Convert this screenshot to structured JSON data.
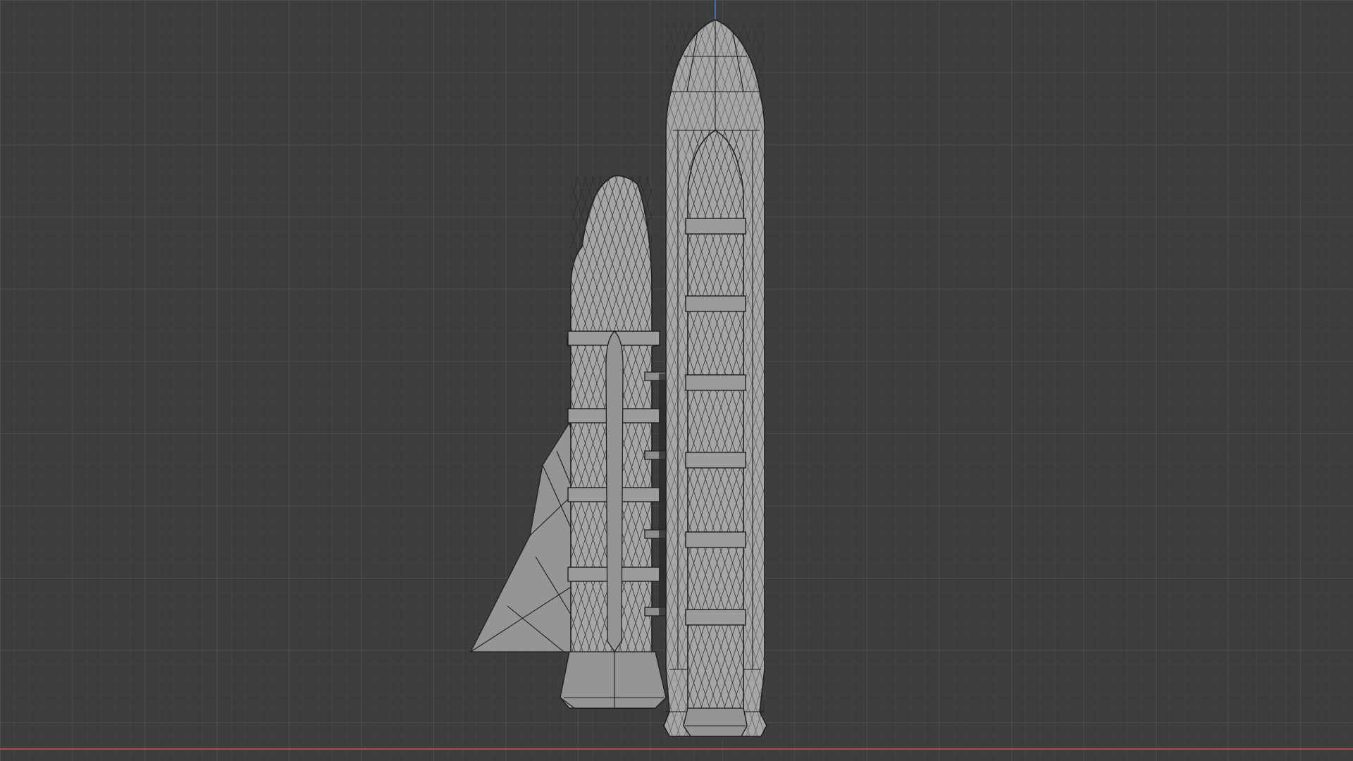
{
  "viewport": {
    "editor": "3D Viewport",
    "view_mode": "wireframe-overlay",
    "background_color": "#3d3d3d",
    "grid_minor_color": "#474747",
    "grid_major_color": "#555555",
    "x_axis_color": "#b04a4a",
    "z_axis_color": "#4a6fb0"
  },
  "scene": {
    "objects": [
      {
        "name": "orbiter",
        "kind": "mesh",
        "shape": "space-shuttle-orbiter"
      },
      {
        "name": "external-tank",
        "kind": "mesh",
        "shape": "external-fuel-tank"
      },
      {
        "name": "solid-rocket-booster",
        "kind": "mesh",
        "shape": "solid-rocket-booster"
      },
      {
        "name": "attach-struts",
        "kind": "mesh",
        "shape": "connector-struts"
      }
    ],
    "mesh_color": "#a6a6a6",
    "wire_color": "#1c1c1c"
  }
}
